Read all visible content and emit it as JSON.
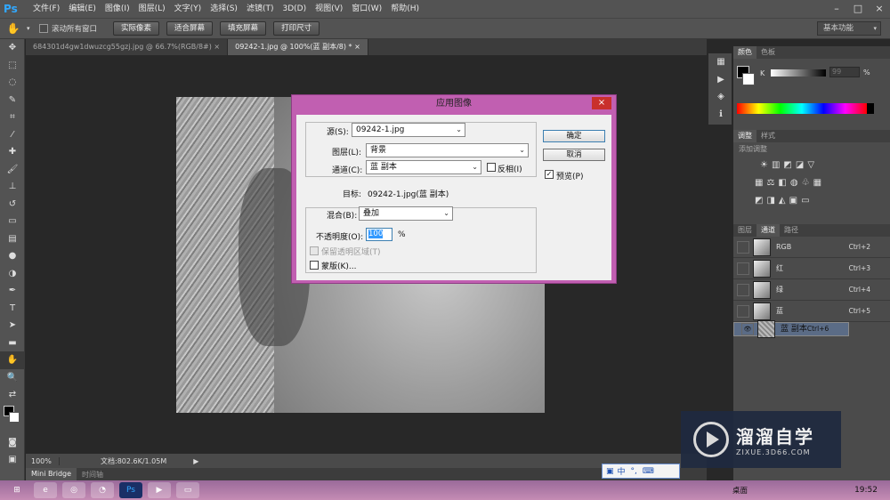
{
  "menubar": {
    "logo": "Ps",
    "items": [
      "文件(F)",
      "编辑(E)",
      "图像(I)",
      "图层(L)",
      "文字(Y)",
      "选择(S)",
      "滤镜(T)",
      "3D(D)",
      "视图(V)",
      "窗口(W)",
      "帮助(H)"
    ]
  },
  "window_controls": [
    "–",
    "□",
    "×"
  ],
  "options": {
    "checkbox_label": "滚动所有窗口",
    "buttons": [
      "实际像素",
      "适合屏幕",
      "填充屏幕",
      "打印尺寸"
    ],
    "workspace": "基本功能"
  },
  "tabs": [
    {
      "label": "684301d4gw1dwuzcg55gzj.jpg @ 66.7%(RGB/8#)",
      "close": "×"
    },
    {
      "label": "09242-1.jpg @ 100%(蓝 副本/8) *",
      "close": "×"
    }
  ],
  "status": {
    "zoom": "100%",
    "doc": "文档:802.6K/1.05M"
  },
  "minibridge": {
    "tabs": [
      "Mini Bridge",
      "时间轴"
    ]
  },
  "color_panel": {
    "tabs": [
      "颜色",
      "色板"
    ],
    "channel": "K",
    "value": "99",
    "unit": "%"
  },
  "adjust_panel": {
    "tabs": [
      "调整",
      "样式"
    ],
    "hint": "添加调整"
  },
  "layers_panel": {
    "tabs": [
      "图层",
      "通道",
      "路径"
    ],
    "channels": [
      {
        "name": "RGB",
        "shortcut": "Ctrl+2"
      },
      {
        "name": "红",
        "shortcut": "Ctrl+3"
      },
      {
        "name": "绿",
        "shortcut": "Ctrl+4"
      },
      {
        "name": "蓝",
        "shortcut": "Ctrl+5"
      },
      {
        "name": "蓝 副本",
        "shortcut": "Ctrl+6"
      }
    ]
  },
  "dialog": {
    "title": "应用图像",
    "close": "×",
    "source_label": "源(S):",
    "source_value": "09242-1.jpg",
    "layer_label": "图层(L):",
    "layer_value": "背景",
    "channel_label": "通道(C):",
    "channel_value": "蓝 副本",
    "invert_label": "反相(I)",
    "target_label": "目标:",
    "target_value": "09242-1.jpg(蓝 副本)",
    "blend_label": "混合(B):",
    "blend_value": "叠加",
    "opacity_label": "不透明度(O):",
    "opacity_value": "100",
    "opacity_unit": "%",
    "preserve_label": "保留透明区域(T)",
    "mask_label": "蒙版(K)...",
    "ok": "确定",
    "cancel": "取消",
    "preview_label": "预览(P)"
  },
  "watermark": {
    "brand": "溜溜自学",
    "url": "ZIXUE.3D66.COM"
  },
  "ime": {
    "text": "中"
  },
  "taskbar": {
    "desktop": "桌面",
    "time": "19:52"
  }
}
